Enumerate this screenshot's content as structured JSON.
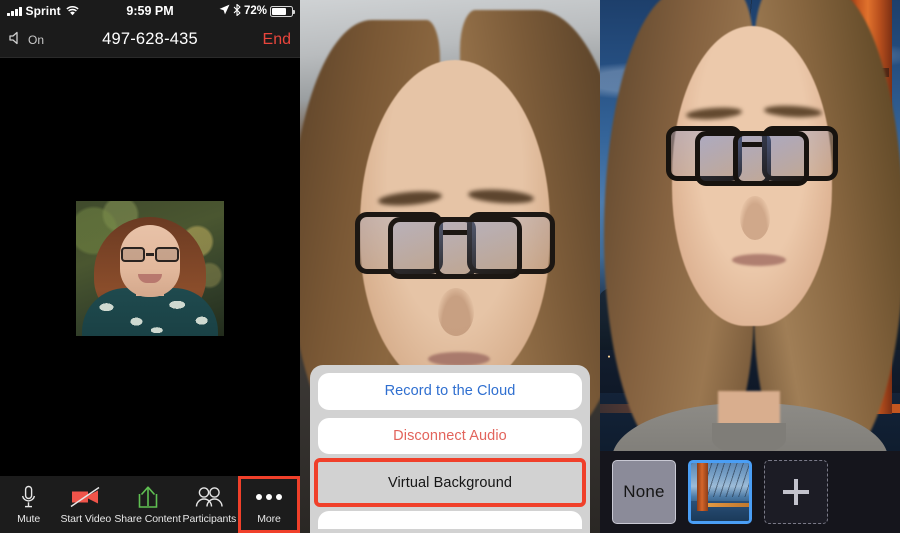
{
  "panel1": {
    "status_bar": {
      "carrier": "Sprint",
      "time": "9:59 PM",
      "battery_percent": "72%",
      "signal_icon": "signal-bars-icon",
      "wifi_icon": "wifi-icon",
      "location_icon": "location-arrow-icon",
      "bluetooth_icon": "bluetooth-icon",
      "battery_icon": "battery-icon"
    },
    "call_header": {
      "speaker_label": "On",
      "speaker_icon": "speaker-icon",
      "meeting_id": "497-628-435",
      "end_label": "End",
      "end_color": "#e8453c"
    },
    "toolbar": {
      "items": [
        {
          "label": "Mute",
          "icon": "microphone-icon"
        },
        {
          "label": "Start Video",
          "icon": "video-off-icon"
        },
        {
          "label": "Share Content",
          "icon": "share-up-arrow-icon"
        },
        {
          "label": "Participants",
          "icon": "people-icon"
        },
        {
          "label": "More",
          "icon": "ellipsis-icon"
        }
      ],
      "highlight_color": "#f0402a",
      "highlighted_item": "More"
    }
  },
  "panel2": {
    "action_sheet": {
      "options": [
        {
          "label": "Record to the Cloud",
          "style": "default-blue"
        },
        {
          "label": "Disconnect Audio",
          "style": "destructive-red"
        },
        {
          "label": "Virtual Background",
          "style": "highlighted-dark"
        }
      ],
      "highlight_color": "#f0402a",
      "highlighted_option": "Virtual Background"
    }
  },
  "panel3": {
    "background_picker": {
      "none_label": "None",
      "add_icon": "plus-icon",
      "selected_index": 1,
      "selection_color": "#4a9ef5",
      "tiles": [
        {
          "name": "none-background-tile",
          "label": "None"
        },
        {
          "name": "golden-gate-bridge-background-tile",
          "label": ""
        },
        {
          "name": "add-background-tile",
          "label": "+"
        }
      ]
    }
  }
}
